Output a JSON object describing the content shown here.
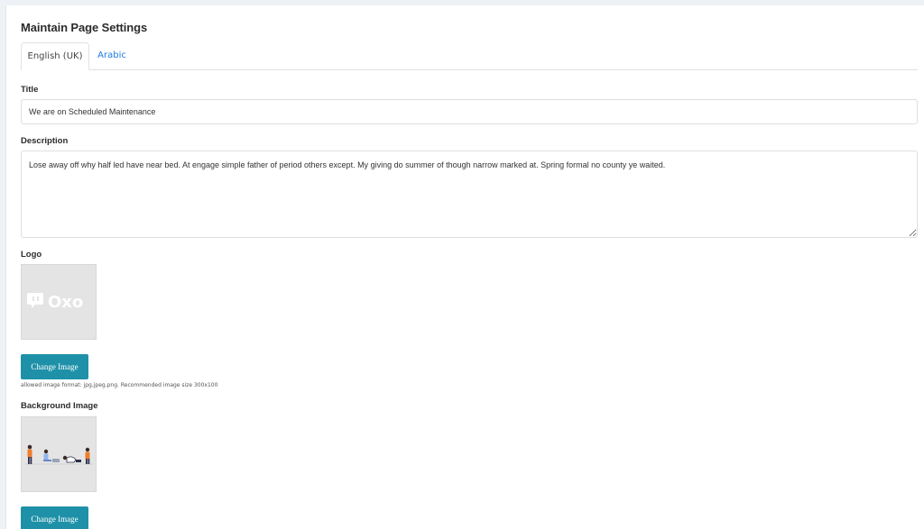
{
  "page": {
    "title": "Maintain Page Settings"
  },
  "tabs": [
    {
      "label": "English (UK)",
      "active": true
    },
    {
      "label": "Arabic",
      "active": false
    }
  ],
  "fields": {
    "title": {
      "label": "Title",
      "value": "We are on Scheduled Maintenance"
    },
    "description": {
      "label": "Description",
      "value": "Lose away off why half led have near bed. At engage simple father of period others except. My giving do summer of though narrow marked at. Spring formal no county ye waited."
    },
    "logo": {
      "label": "Logo",
      "logo_text": "Oxo",
      "button_label": "Change Image",
      "hint": "allowed image format: jpg,jpeg,png. Recommended image size 300x100"
    },
    "background": {
      "label": "Background Image",
      "button_label": "Change Image"
    }
  },
  "colors": {
    "accent_button": "#1e91a8",
    "tab_link": "#1a7de0"
  }
}
